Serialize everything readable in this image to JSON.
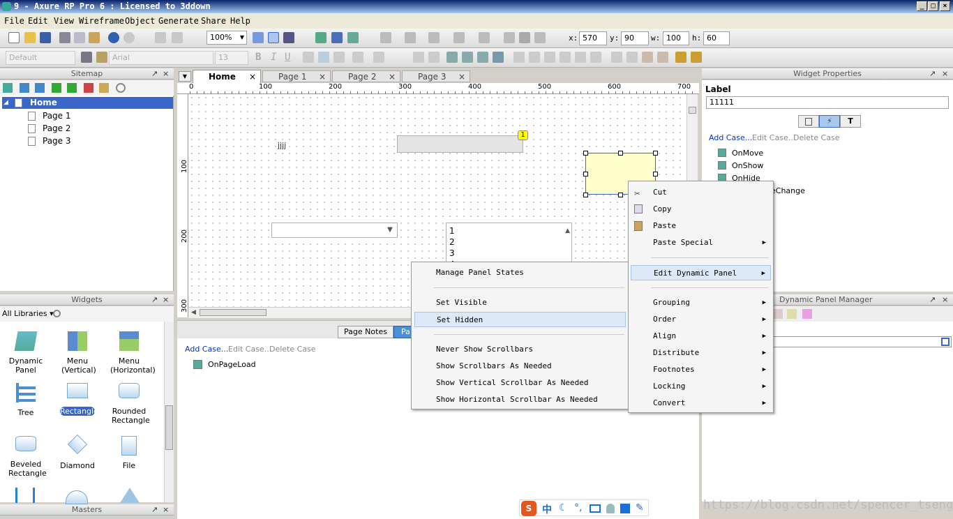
{
  "window": {
    "title": "9 - Axure RP Pro 6 : Licensed to 3ddown",
    "min": "_",
    "max": "□",
    "close": "×"
  },
  "menu": [
    "File",
    "Edit",
    "View",
    "Wireframe",
    "Object",
    "Generate",
    "Share",
    "Help"
  ],
  "toolbar": {
    "zoom": "100%",
    "x_label": "x:",
    "x": "570",
    "y_label": "y:",
    "y": "90",
    "w_label": "w:",
    "w": "100",
    "h_label": "h:",
    "h": "60",
    "style": "Default",
    "font": "Arial",
    "font_size": "13",
    "bold": "B",
    "italic": "I",
    "underline": "U"
  },
  "sitemap": {
    "title": "Sitemap",
    "items": [
      {
        "label": "Home"
      },
      {
        "label": "Page 1"
      },
      {
        "label": "Page 2"
      },
      {
        "label": "Page 3"
      }
    ]
  },
  "widgets": {
    "title": "Widgets",
    "library": "All Libraries",
    "items": [
      {
        "label": "Dynamic Panel"
      },
      {
        "label": "Menu (Vertical)"
      },
      {
        "label": "Menu (Horizontal)"
      },
      {
        "label": "Tree"
      },
      {
        "label": "Rectangle"
      },
      {
        "label": "Rounded Rectangle"
      },
      {
        "label": "Beveled Rectangle"
      },
      {
        "label": "Diamond"
      },
      {
        "label": "File"
      }
    ]
  },
  "masters": {
    "title": "Masters"
  },
  "tabs": [
    {
      "label": "Home"
    },
    {
      "label": "Page 1"
    },
    {
      "label": "Page 2"
    },
    {
      "label": "Page 3"
    }
  ],
  "ruler": {
    "h": [
      "0",
      "100",
      "200",
      "300",
      "400",
      "500",
      "600",
      "700"
    ],
    "v": [
      "100",
      "200",
      "300"
    ]
  },
  "canvas": {
    "text_widget": "jjjj",
    "footnote": "1",
    "list_items": [
      "1",
      "2",
      "3",
      "4"
    ]
  },
  "page_notes": {
    "tab1": "Page Notes",
    "tab2": "Pa",
    "add_case": "Add Case...",
    "edit_case": "Edit Case...",
    "delete_case": "Delete Case",
    "event": "OnPageLoad"
  },
  "widget_props": {
    "title": "Widget Properties",
    "label_title": "Label",
    "label_value": "11111",
    "add_case": "Add Case...",
    "edit_case": "Edit Case...",
    "delete_case": "Delete Case",
    "events": [
      "OnMove",
      "OnShow",
      "OnHide",
      "eChange"
    ]
  },
  "dp_manager": {
    "title": "Dynamic Panel Manager"
  },
  "context_menu": {
    "items": [
      {
        "label": "Cut"
      },
      {
        "label": "Copy"
      },
      {
        "label": "Paste"
      },
      {
        "label": "Paste Special"
      },
      {
        "label": "Edit Dynamic Panel"
      },
      {
        "label": "Grouping"
      },
      {
        "label": "Order"
      },
      {
        "label": "Align"
      },
      {
        "label": "Distribute"
      },
      {
        "label": "Footnotes"
      },
      {
        "label": "Locking"
      },
      {
        "label": "Convert"
      }
    ]
  },
  "submenu": {
    "items": [
      {
        "label": "Manage Panel States"
      },
      {
        "label": "Set Visible"
      },
      {
        "label": "Set Hidden"
      },
      {
        "label": "Never Show Scrollbars"
      },
      {
        "label": "Show Scrollbars As Needed"
      },
      {
        "label": "Show Vertical Scrollbar As Needed"
      },
      {
        "label": "Show Horizontal Scrollbar As Needed"
      }
    ]
  },
  "watermark": "https://blog.csdn.net/spencer_tseng",
  "ime_bar": {
    "cn": "中"
  },
  "colors": {
    "selection": "#3a66cc",
    "highlight": "#dde8f8",
    "panel_fill": "#ffffcc"
  }
}
